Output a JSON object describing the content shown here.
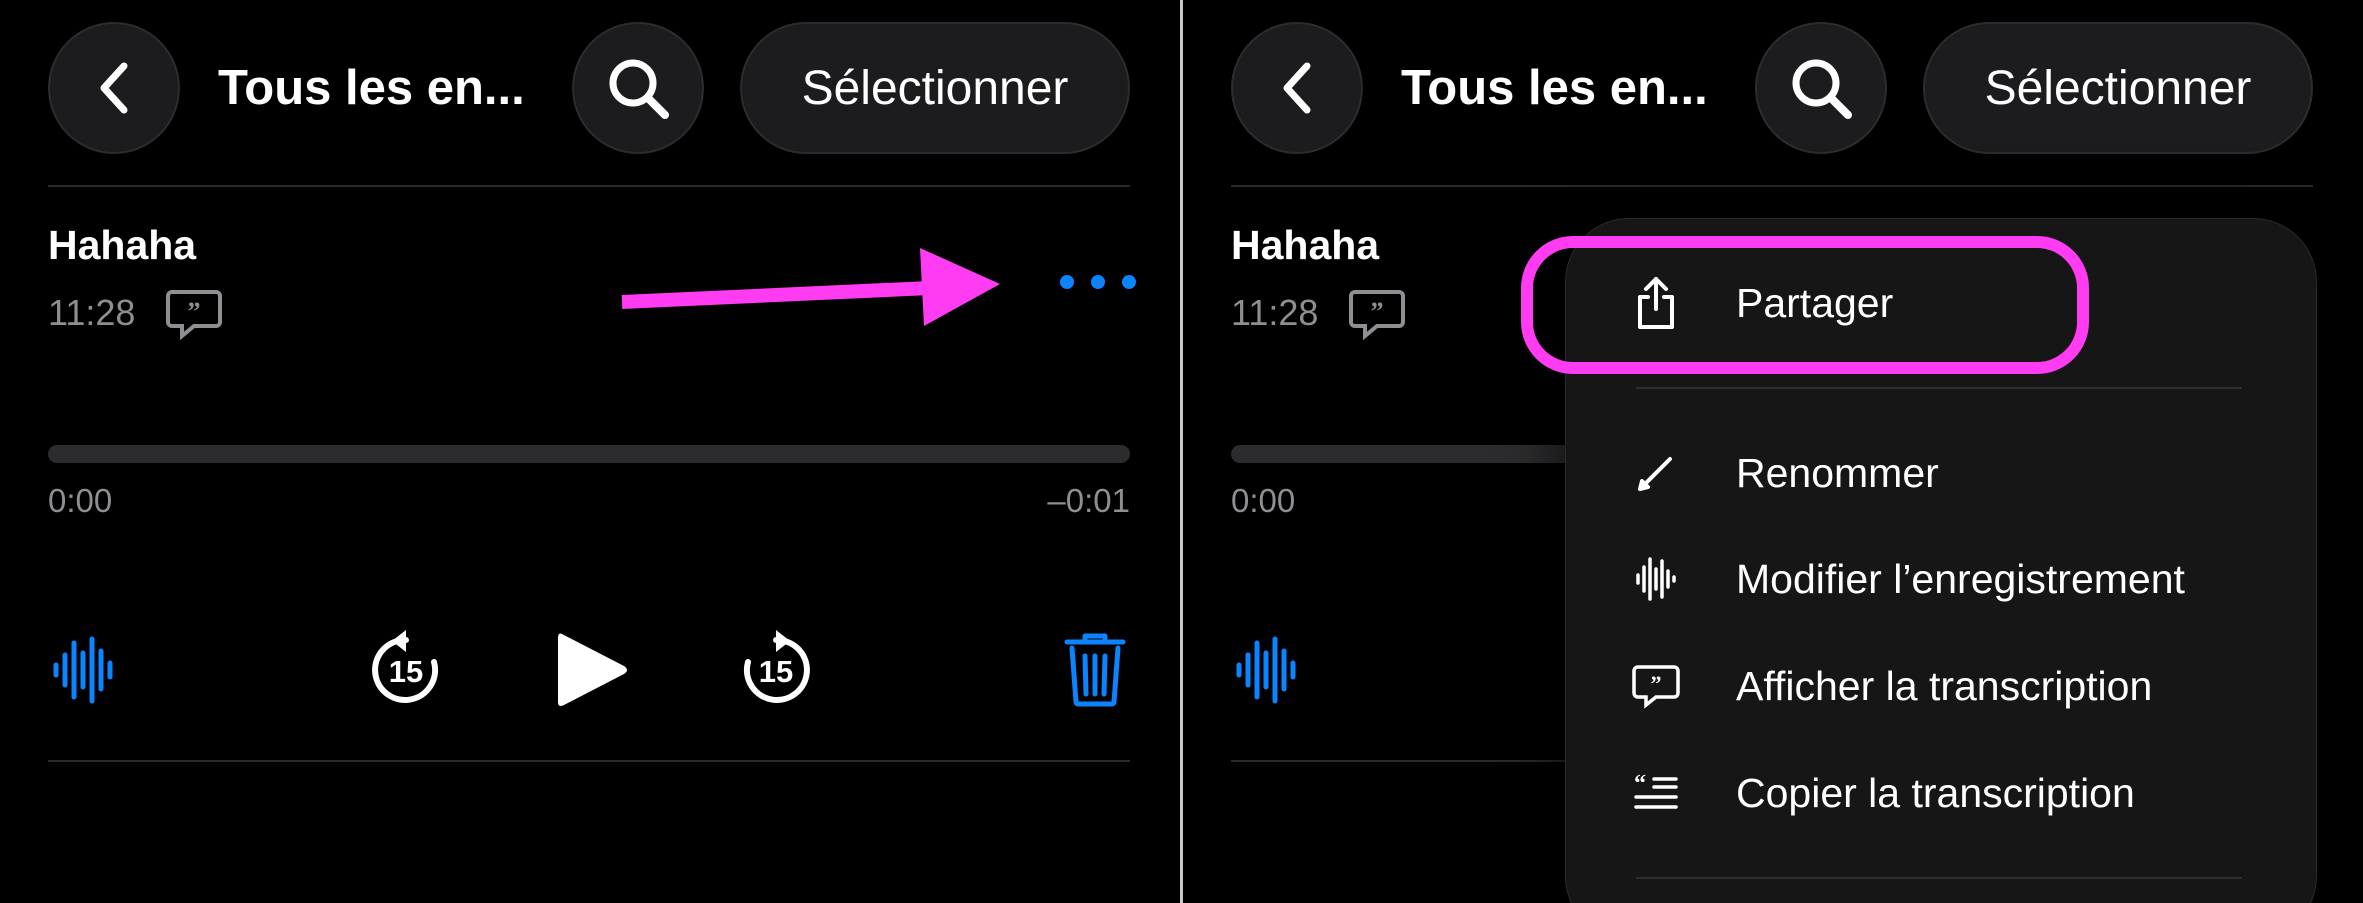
{
  "colors": {
    "accent": "#0a84ff",
    "annotation": "#ff3cf2",
    "background": "#000000",
    "secondary_text": "#8e8e93"
  },
  "header": {
    "title": "Tous les en...",
    "select_label": "Sélectionner",
    "back_icon": "chevron-left-icon",
    "search_icon": "search-icon"
  },
  "recording": {
    "title": "Hahaha",
    "time": "11:28",
    "elapsed": "0:00",
    "remaining": "–0:01",
    "progress": 0
  },
  "controls": {
    "skip_back_seconds": "15",
    "skip_forward_seconds": "15"
  },
  "menu": {
    "items": [
      {
        "label": "Partager",
        "icon": "share-icon"
      },
      {
        "label": "Renommer",
        "icon": "pencil-icon"
      },
      {
        "label": "Modifier l’enregistrement",
        "icon": "waveform-icon"
      },
      {
        "label": "Afficher la transcription",
        "icon": "transcript-bubble-icon"
      },
      {
        "label": "Copier la transcription",
        "icon": "copy-transcript-icon"
      }
    ]
  }
}
